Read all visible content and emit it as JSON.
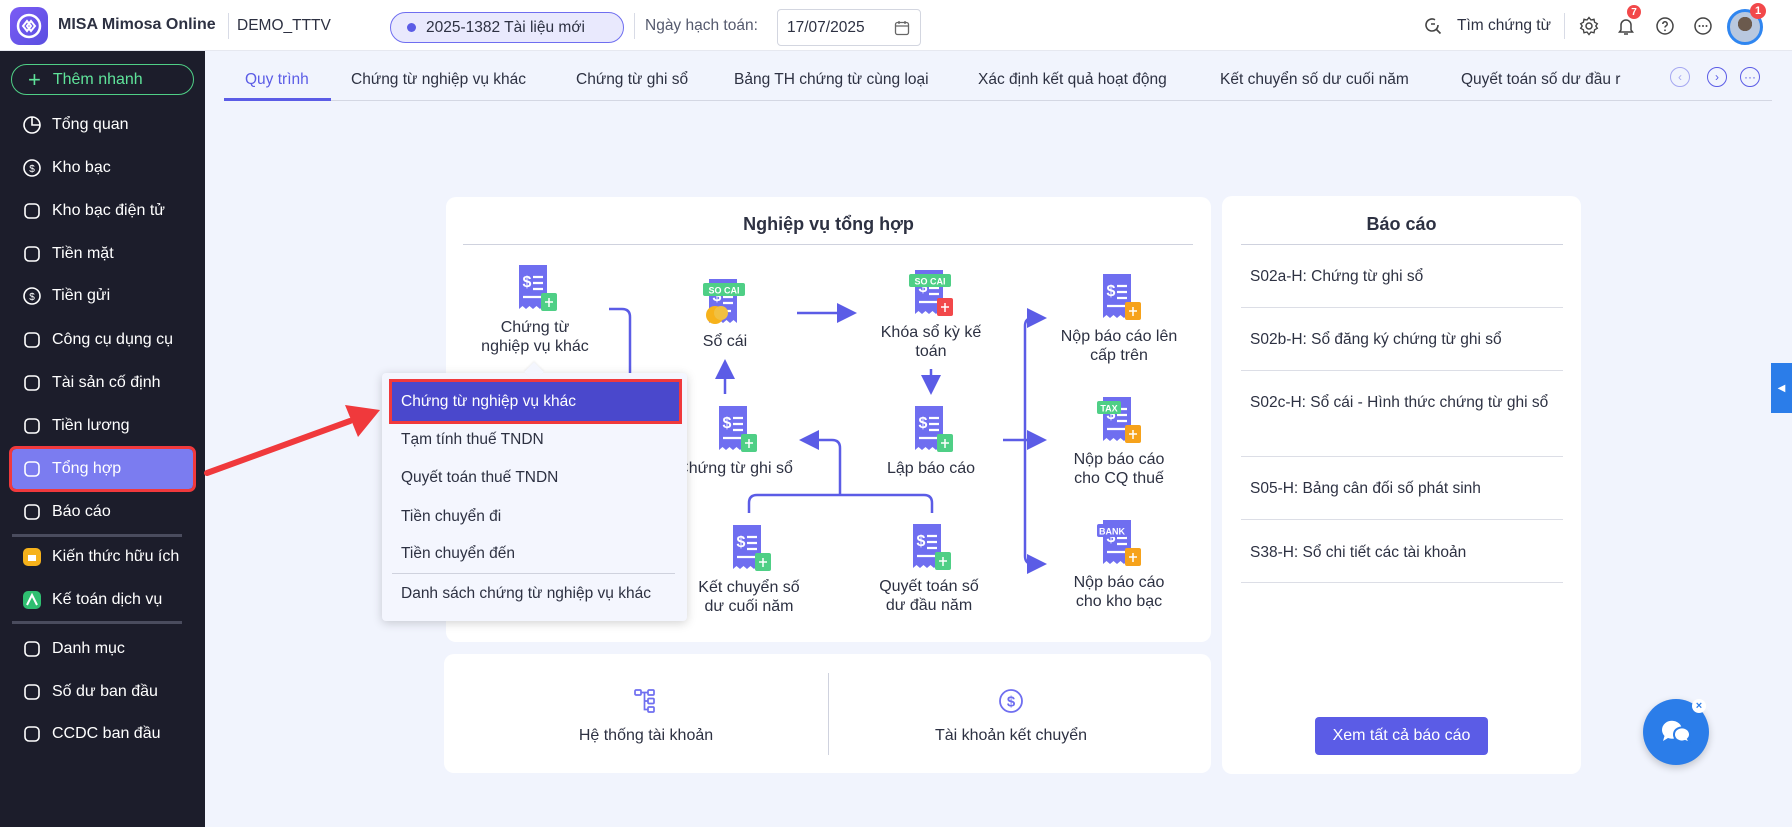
{
  "header": {
    "app_title": "MISA Mimosa Online",
    "company": "DEMO_TTTV",
    "document_pill": "2025-1382 Tài liệu mới",
    "date_label": "Ngày hạch toán:",
    "date_value": "17/07/2025",
    "search_label": "Tìm chứng từ",
    "notification_count": "7",
    "avatar_badge": "1"
  },
  "sidebar": {
    "quick_add": "Thêm nhanh",
    "items": [
      {
        "label": "Tổng quan"
      },
      {
        "label": "Kho bạc"
      },
      {
        "label": "Kho bạc điện tử"
      },
      {
        "label": "Tiền mặt"
      },
      {
        "label": "Tiền gửi"
      },
      {
        "label": "Công cụ dụng cụ"
      },
      {
        "label": "Tài sản cố định"
      },
      {
        "label": "Tiền lương"
      },
      {
        "label": "Tổng hợp"
      },
      {
        "label": "Báo cáo"
      },
      {
        "label": "Kiến thức hữu ích"
      },
      {
        "label": "Kế toán dịch vụ"
      },
      {
        "label": "Danh mục"
      },
      {
        "label": "Số dư ban đầu"
      },
      {
        "label": "CCDC ban đầu"
      }
    ],
    "active": "Tổng hợp"
  },
  "tabs": [
    "Quy trình",
    "Chứng từ nghiệp vụ khác",
    "Chứng từ ghi sổ",
    "Bảng TH chứng từ cùng loại",
    "Xác định kết quả hoạt động",
    "Kết chuyển số dư cuối năm",
    "Quyết toán số dư đầu r"
  ],
  "workflow": {
    "title": "Nghiệp vụ tổng hợp",
    "nodes": [
      {
        "lines": [
          "Chứng từ",
          "nghiệp vụ khác"
        ]
      },
      {
        "lines": [
          "Sổ cái"
        ],
        "icon_text": "SO CAI"
      },
      {
        "lines": [
          "Khóa sổ kỳ kế",
          "toán"
        ],
        "icon_text": "SO CAI"
      },
      {
        "lines": [
          "Chứng từ ghi sổ"
        ]
      },
      {
        "lines": [
          "Lập báo cáo"
        ]
      },
      {
        "lines": [
          "Kết chuyển số",
          "dư cuối năm"
        ]
      },
      {
        "lines": [
          "Quyết toán số",
          "dư đầu năm"
        ]
      },
      {
        "lines": [
          "Nộp báo cáo lên",
          "cấp trên"
        ]
      },
      {
        "lines": [
          "Nộp báo cáo",
          "cho CQ thuế"
        ],
        "icon_text": "TAX"
      },
      {
        "lines": [
          "Nộp báo cáo",
          "cho kho bạc"
        ],
        "icon_text": "BANK"
      }
    ]
  },
  "shortcuts": [
    "Hệ thống tài khoản",
    "Tài khoản kết chuyển"
  ],
  "reports": {
    "title": "Báo cáo",
    "items": [
      "S02a-H: Chứng từ ghi sổ",
      "S02b-H: Sổ đăng ký chứng từ ghi sổ",
      "S02c-H: Sổ cái - Hình thức chứng từ ghi sổ",
      "S05-H: Bảng cân đối số phát sinh",
      "S38-H: Sổ chi tiết các tài khoản"
    ],
    "view_all": "Xem tất cả báo cáo"
  },
  "dropdown": {
    "items": [
      "Chứng từ nghiệp vụ khác",
      "Tạm tính thuế TNDN",
      "Quyết toán thuế TNDN",
      "Tiền chuyển đi",
      "Tiền chuyển đến",
      "Danh sách chứng từ nghiệp vụ khác"
    ],
    "selected": "Chứng từ nghiệp vụ khác"
  },
  "colors": {
    "primary": "#5b5ce6",
    "sidebar_bg": "#1c1d2b",
    "highlight_red": "#f0393c",
    "success": "#4fcf86"
  }
}
